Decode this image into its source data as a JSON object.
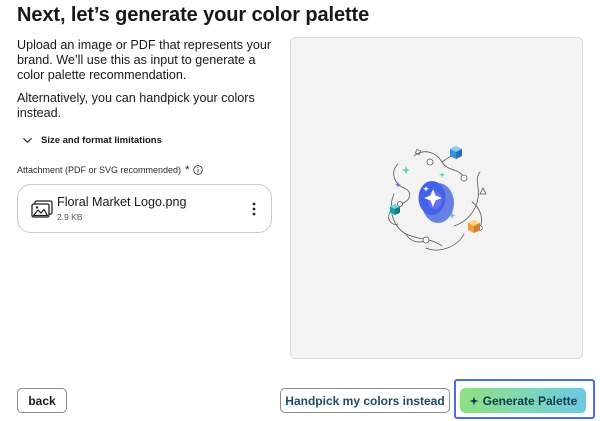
{
  "header": {
    "title": "Next, let’s generate your color palette"
  },
  "intro": {
    "paragraph1": "Upload an image or PDF that represents your brand. We’ll use this as input to generate a color palette recommendation.",
    "paragraph2": "Alternatively, you can handpick your colors instead."
  },
  "limitations": {
    "label": "Size and format limitations",
    "icon": "chevron-down-icon"
  },
  "attachment": {
    "label": "Attachment (PDF or SVG recommended)",
    "required_mark": "*",
    "info_icon": "info-icon",
    "file": {
      "name": "Floral Market Logo.png",
      "size": "2.9 KB",
      "icon": "image-icon",
      "menu_icon": "more-vertical-icon"
    }
  },
  "preview": {
    "illustration": "ai-palette-illustration"
  },
  "footer": {
    "back_label": "back",
    "handpick_label": "Handpick my colors instead",
    "generate_label": "Generate Palette",
    "generate_icon": "sparkle-icon"
  },
  "colors": {
    "text": "#181818",
    "accent_text": "#1f4a66",
    "focus_ring": "#4a6ee0",
    "gradient_start": "#8fe081",
    "gradient_end": "#6cc9e2"
  }
}
